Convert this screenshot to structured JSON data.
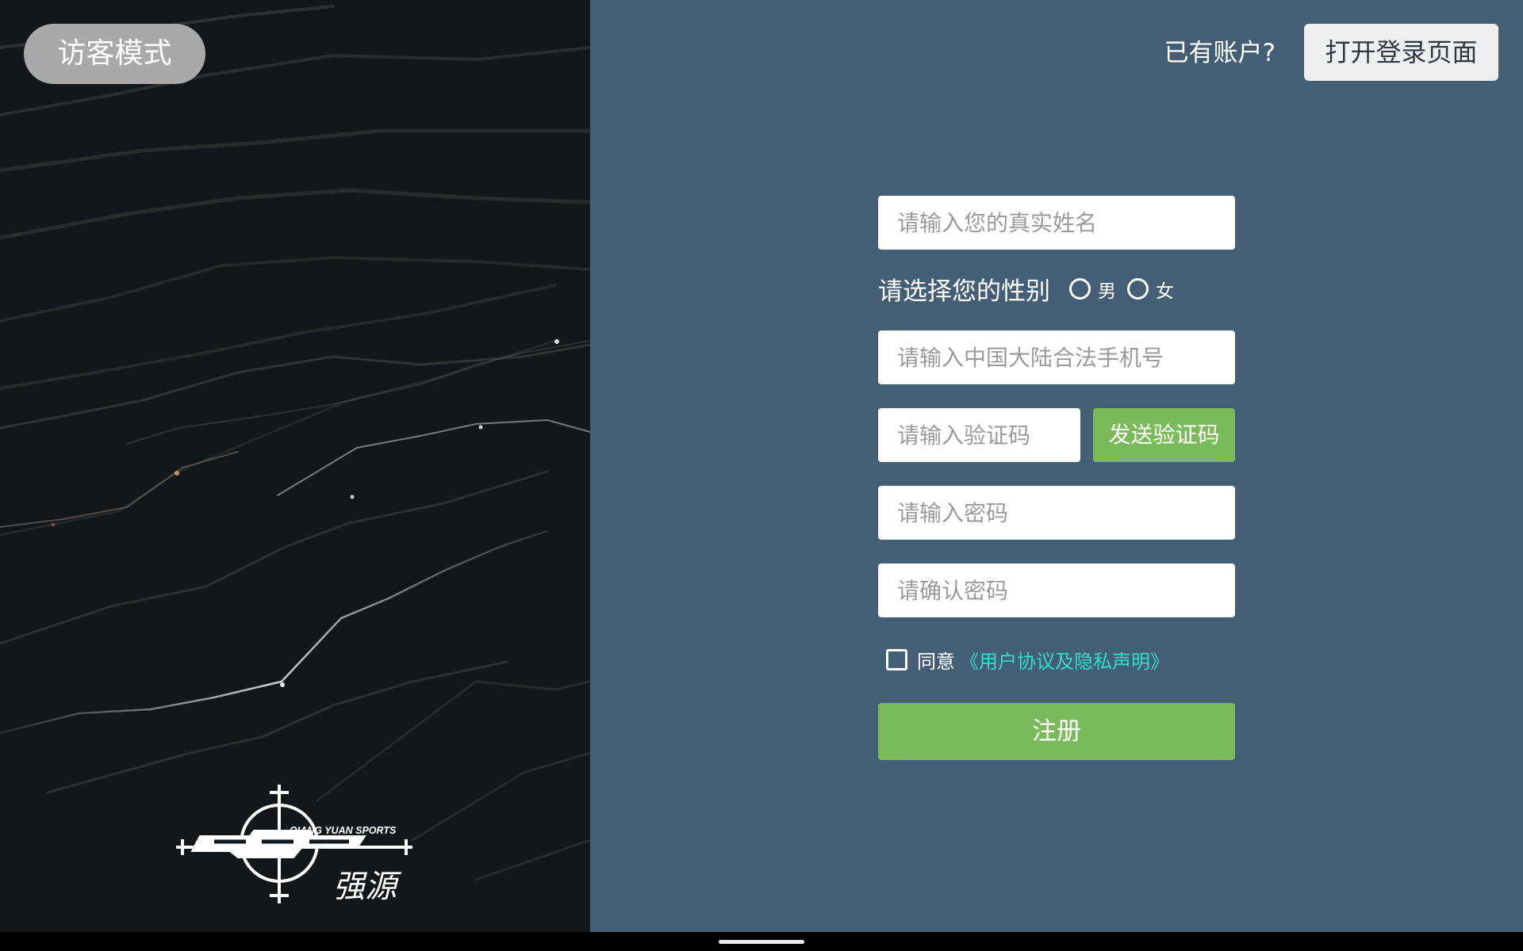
{
  "guest_mode": {
    "label": "访客模式"
  },
  "header": {
    "have_account_text": "已有账户?",
    "open_login_label": "打开登录页面"
  },
  "form": {
    "name_placeholder": "请输入您的真实姓名",
    "gender": {
      "label": "请选择您的性别",
      "options": [
        {
          "label": "男",
          "selected": false
        },
        {
          "label": "女",
          "selected": false
        }
      ]
    },
    "phone_placeholder": "请输入中国大陆合法手机号",
    "code_placeholder": "请输入验证码",
    "send_code_label": "发送验证码",
    "password_placeholder": "请输入密码",
    "confirm_password_placeholder": "请确认密码",
    "agree": {
      "checked": false,
      "text": "同意",
      "link_text": "《用户协议及隐私声明》"
    },
    "register_label": "注册"
  },
  "logo": {
    "brand_text_en": "QIANG YUAN SPORTS",
    "brand_text_cn": "强源"
  },
  "colors": {
    "left_background": "#12171b",
    "right_background": "#445e76",
    "accent_green": "#7aba5b",
    "link_cyan": "#2ee0cb",
    "guest_button": "#a9a9ab"
  }
}
